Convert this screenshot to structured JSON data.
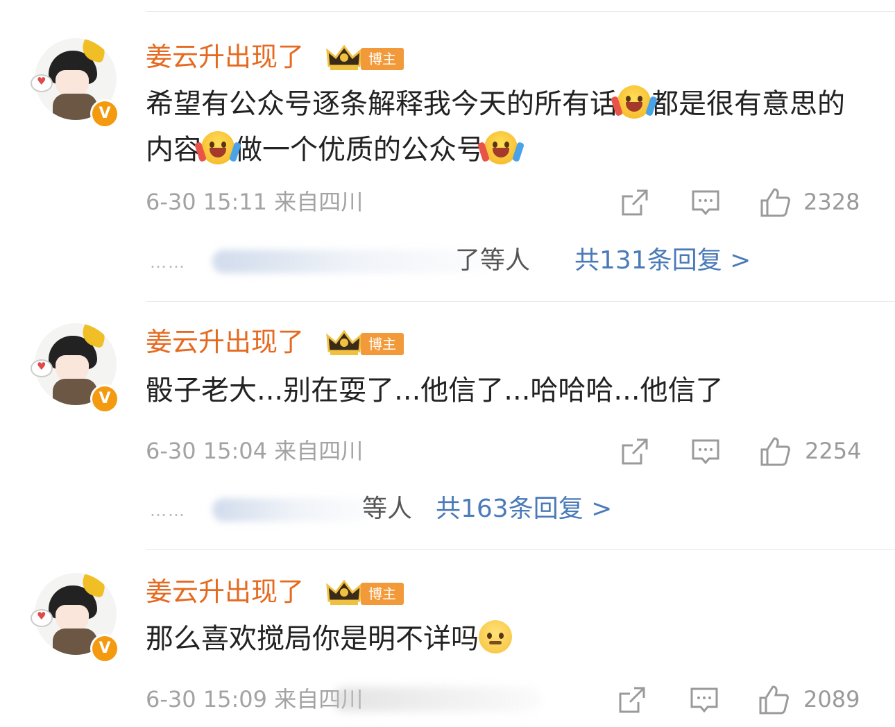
{
  "comments": [
    {
      "username": "姜云升出现了",
      "badge_label": "博主",
      "verified_mark": "V",
      "content_parts": [
        "希望有公众号逐条解释我今天的所有话",
        "都是很有意思的内容",
        "做一个优质的公众号"
      ],
      "time": "6-30 15:11",
      "location": "来自四川",
      "like_count": "2328",
      "reply_dots": "……",
      "reply_users_suffix": "了等人",
      "reply_count_label": "共131条回复 >"
    },
    {
      "username": "姜云升出现了",
      "badge_label": "博主",
      "verified_mark": "V",
      "content_text": "骰子老大...别在耍了...他信了...哈哈哈...他信了",
      "time": "6-30 15:04",
      "location": "来自四川",
      "like_count": "2254",
      "reply_dots": "……",
      "reply_users_suffix": "等人",
      "reply_count_label": "共163条回复 >"
    },
    {
      "username": "姜云升出现了",
      "badge_label": "博主",
      "verified_mark": "V",
      "content_text": "那么喜欢搅局你是明不详吗",
      "time": "6-30 15:09",
      "location": "来自四川",
      "like_count": "2089"
    }
  ],
  "icons": {
    "share": "share-icon",
    "comment": "comment-icon",
    "like": "thumbs-up-icon",
    "laugh_emoji": "laugh-cry-emoji",
    "sad_emoji": "sad-emoji"
  },
  "colors": {
    "username": "#e56a20",
    "badge": "#f29a39",
    "reply_link": "#4a7ab8",
    "meta": "#a3a3a3"
  }
}
